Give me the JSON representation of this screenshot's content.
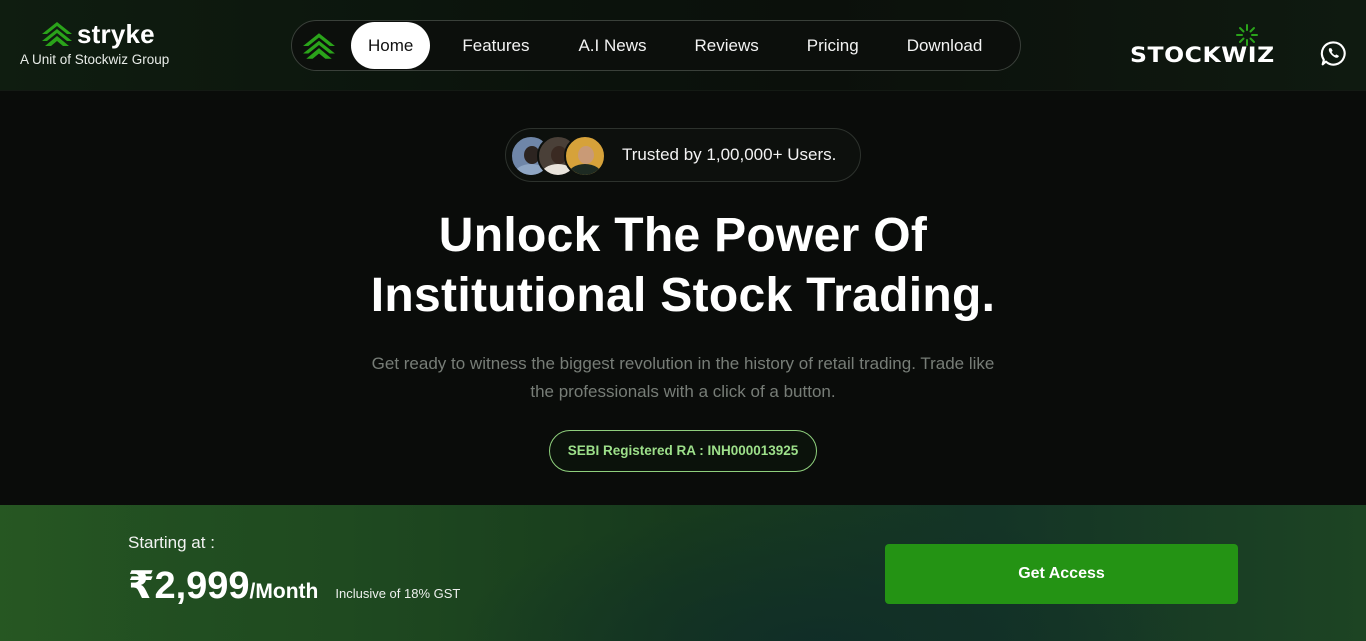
{
  "brand": {
    "name": "stryke",
    "tagline": "A Unit of Stockwiz Group",
    "logo_icon": "chevron-stack-logo-icon",
    "accent_color": "#2aa31a"
  },
  "nav": {
    "items": [
      {
        "label": "Home",
        "active": true
      },
      {
        "label": "Features",
        "active": false
      },
      {
        "label": "A.I News",
        "active": false
      },
      {
        "label": "Reviews",
        "active": false
      },
      {
        "label": "Pricing",
        "active": false
      },
      {
        "label": "Download",
        "active": false
      }
    ]
  },
  "partner": {
    "logo_text": "STOCKWIZ",
    "contact_icon": "whatsapp-icon"
  },
  "hero": {
    "trust_text": "Trusted by 1,00,000+ Users.",
    "headline_line1": "Unlock The Power Of",
    "headline_line2": "Institutional Stock Trading.",
    "subtext_line1": "Get ready to witness the biggest revolution in the history of retail trading. Trade like",
    "subtext_line2": "the professionals with a click of a button.",
    "sebi_badge": "SEBI Registered RA : INH000013925"
  },
  "pricing": {
    "starting_label": "Starting at :",
    "price": "₹2,999",
    "period": "/Month",
    "tax_note": "Inclusive of 18% GST",
    "cta_label": "Get Access",
    "cta_color": "#249314"
  }
}
